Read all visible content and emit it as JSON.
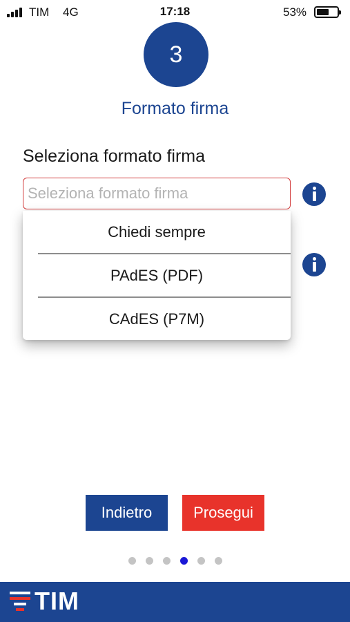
{
  "status_bar": {
    "carrier": "TIM",
    "network": "4G",
    "time": "17:18",
    "battery": "53%",
    "battery_level": 0.53
  },
  "step": {
    "number": "3",
    "title": "Formato firma"
  },
  "form": {
    "label": "Seleziona formato firma",
    "select_placeholder": "Seleziona formato firma",
    "options": [
      "Chiedi sempre",
      "PAdES (PDF)",
      "CAdES (P7M)"
    ]
  },
  "buttons": {
    "back": "Indietro",
    "next": "Prosegui"
  },
  "pagination": {
    "total": 6,
    "current": 4
  },
  "footer": {
    "brand": "TIM"
  },
  "colors": {
    "primary": "#1c4591",
    "accent": "#e8332b",
    "active_dot": "#1a18d6"
  },
  "icons": [
    "signal-icon",
    "battery-icon",
    "info-icon",
    "tim-logo-icon"
  ]
}
